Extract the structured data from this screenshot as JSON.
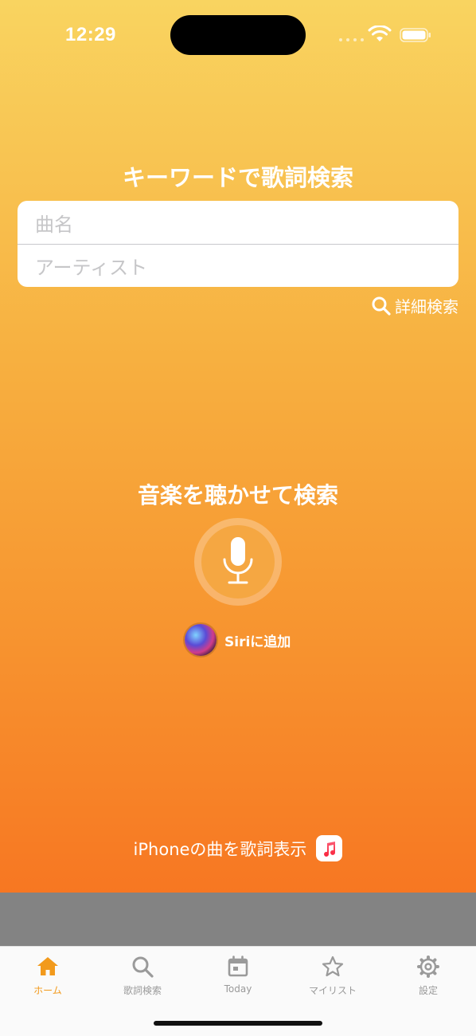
{
  "status_bar": {
    "time": "12:29"
  },
  "keyword_search": {
    "title": "キーワードで歌詞検索",
    "song_placeholder": "曲名",
    "artist_placeholder": "アーティスト",
    "advanced_search_label": "詳細検索"
  },
  "listen_search": {
    "title": "音楽を聴かせて検索",
    "siri_label": "Siriに追加"
  },
  "iphone_lyrics_label": "iPhoneの曲を歌詞表示",
  "tabs": [
    {
      "label": "ホーム",
      "icon": "house-icon",
      "active": true
    },
    {
      "label": "歌詞検索",
      "icon": "search-icon",
      "active": false
    },
    {
      "label": "Today",
      "icon": "calendar-icon",
      "active": false
    },
    {
      "label": "マイリスト",
      "icon": "star-icon",
      "active": false
    },
    {
      "label": "設定",
      "icon": "gear-icon",
      "active": false
    }
  ],
  "colors": {
    "accent": "#f29a1c",
    "gradient_top": "#f9d460",
    "gradient_bottom": "#f77722",
    "tab_inactive": "#9a9a9a"
  }
}
